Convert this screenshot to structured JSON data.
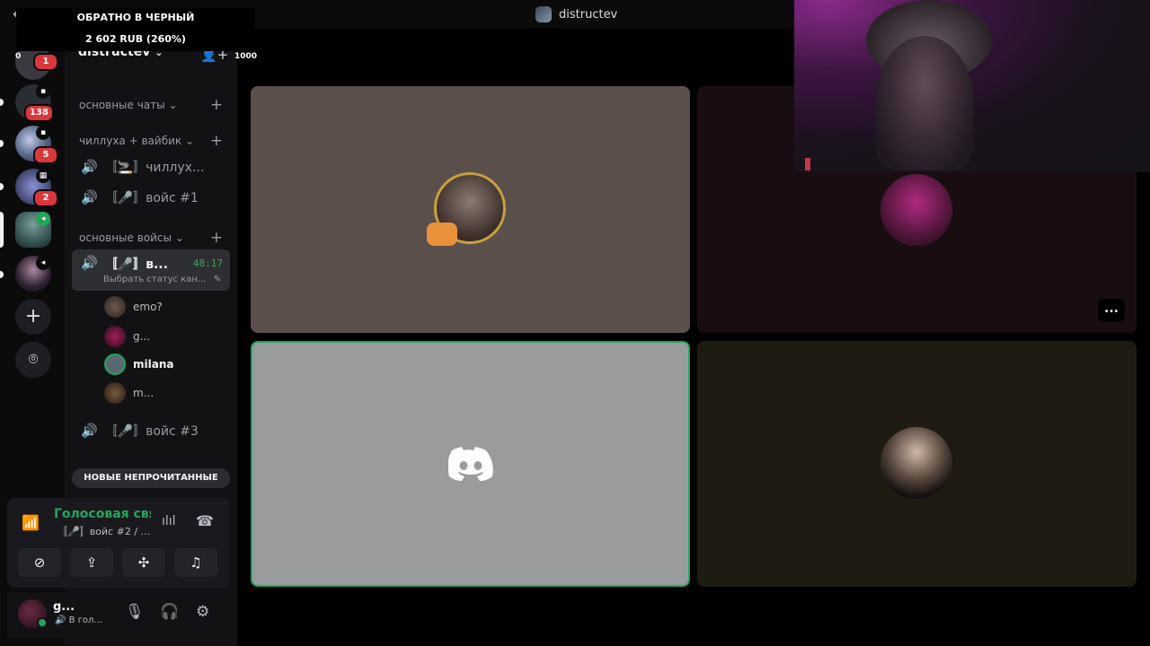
{
  "titlebar": {
    "back_icon": "←",
    "forward_icon": "→",
    "title": "distructev"
  },
  "overlay": {
    "donation_title": "ОБРАТНО В ЧЕРНЫЙ",
    "donation_amount": "2 602 RUB (260%)",
    "counter": "1000"
  },
  "rail": {
    "servers": [
      {
        "badge": "1",
        "color": "#3a3a40"
      },
      {
        "badge": "138",
        "color": "#2a2d33"
      },
      {
        "badge": "5",
        "color": "#5a6a8a"
      },
      {
        "badge": "2",
        "color": "#4a4f7a"
      },
      {
        "badge": "",
        "color": "#3d5a5a"
      },
      {
        "badge": "",
        "color": "#2e2030"
      }
    ],
    "left_edge_digit": "0",
    "add_server_icon": "+",
    "discover_icon": "⌾"
  },
  "sidebar": {
    "server_name": "distructev",
    "server_chevron": "⌄",
    "invite_icon": "👤+",
    "categories": [
      {
        "label": "основные чаты",
        "chevron": "⌄",
        "plus": "+"
      },
      {
        "label": "чиллуха + вайбик",
        "chevron": "⌄",
        "plus": "+"
      },
      {
        "label": "основные войсы",
        "chevron": "⌄",
        "plus": "+"
      }
    ],
    "channels": {
      "chill": "〚🚬〛чиллух...",
      "voice1": "〚🎤〛войс #1",
      "active": "〚🎤〛в...",
      "active_timer": "48:17",
      "active_status": "Выбрать статус кан...",
      "voice3": "〚🎤〛войс #3"
    },
    "members": [
      "emo?",
      "g...",
      "milana",
      "m..."
    ],
    "unread_label": "НОВЫЕ НЕПРОЧИТАННЫЕ"
  },
  "voice_panel": {
    "title": "Голосовая связь",
    "subtitle": "〚🎤〛войс #2 / ...",
    "buttons": [
      "camera-off",
      "share-screen",
      "activities",
      "soundboard"
    ]
  },
  "user_panel": {
    "name": "g...",
    "status": "🔊 В гол..."
  },
  "stage": {
    "tiles": [
      {
        "name": "tile-user-1",
        "bg": "#5b4f4c"
      },
      {
        "name": "tile-user-2",
        "bg": "#1a0d12"
      },
      {
        "name": "tile-user-milana",
        "bg": "#999b9c"
      },
      {
        "name": "tile-user-4",
        "bg": "#1e1c12"
      }
    ],
    "more_icon": "..."
  },
  "colors": {
    "accent_green": "#23a55a",
    "badge_red": "#da373c"
  }
}
